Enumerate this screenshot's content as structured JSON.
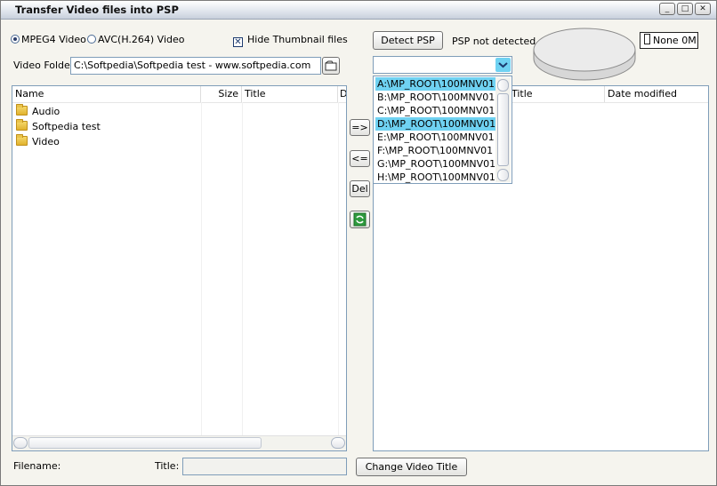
{
  "window": {
    "title": "Transfer Video files into PSP",
    "buttons": [
      "_",
      "□",
      "✕"
    ]
  },
  "options": {
    "mpeg4_label": "MPEG4 Video",
    "avc_label": "AVC(H.264) Video",
    "hide_thumbnail_label": "Hide Thumbnail files",
    "hide_thumbnail_checked": true
  },
  "psp": {
    "detect_label": "Detect PSP",
    "status": "PSP not detected",
    "capacity": "None  0M"
  },
  "video_folder": {
    "label": "Video Folder",
    "value": "C:\\Softpedia\\Softpedia test - www.softpedia.com"
  },
  "left_list": {
    "columns": [
      "Name",
      "Size",
      "Title",
      "D"
    ],
    "rows": [
      "Audio",
      "Softpedia test",
      "Video"
    ]
  },
  "transfer_buttons": {
    "to_psp": "=>",
    "from_psp": "<=",
    "delete": "Del"
  },
  "right_list": {
    "columns": [
      "Title",
      "Date modified"
    ]
  },
  "drive_dropdown": {
    "items": [
      "A:\\MP_ROOT\\100MNV01",
      "B:\\MP_ROOT\\100MNV01",
      "C:\\MP_ROOT\\100MNV01",
      "D:\\MP_ROOT\\100MNV01",
      "E:\\MP_ROOT\\100MNV01",
      "F:\\MP_ROOT\\100MNV01",
      "G:\\MP_ROOT\\100MNV01",
      "H:\\MP_ROOT\\100MNV01"
    ],
    "highlighted": [
      0,
      3
    ]
  },
  "footer": {
    "filename_label": "Filename:",
    "title_label": "Title:",
    "title_value": "",
    "change_title_label": "Change Video Title"
  },
  "colors": {
    "highlight": "#6fd2f2",
    "field_border": "#7f9db9"
  }
}
